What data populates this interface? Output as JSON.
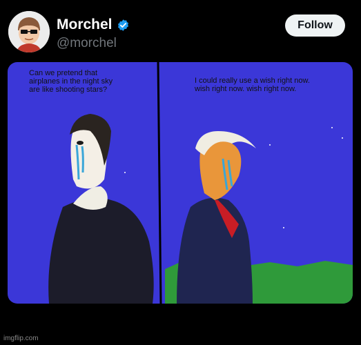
{
  "post": {
    "display_name": "Morchel",
    "handle": "@morchel",
    "follow_label": "Follow",
    "verified": true,
    "accent_color": "#1d9bf0"
  },
  "comic": {
    "panel_left_text": "Can we pretend that airplanes in the night sky are like shooting stars?",
    "panel_right_text": "I could really use a wish right now. wish right now. wish right now.",
    "sky_color": "#3b37d8",
    "grass_color": "#2f9a3a"
  },
  "watermark": "imgflip.com"
}
